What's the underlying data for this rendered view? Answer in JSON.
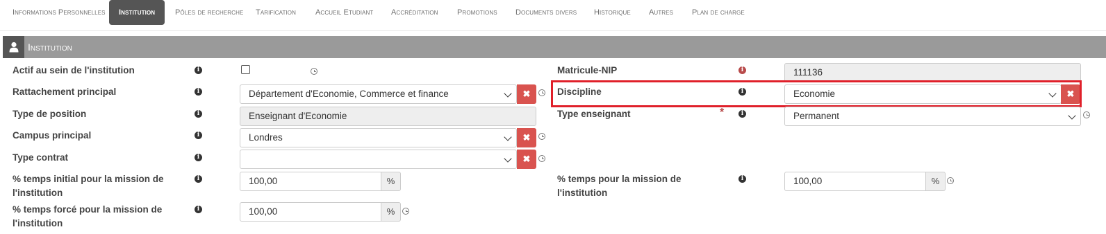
{
  "tabs": [
    {
      "label": "Informations Personnelles"
    },
    {
      "label": "Institution"
    },
    {
      "label": "Pôles de recherche"
    },
    {
      "label": "Tarification"
    },
    {
      "label": "Accueil Etudiant"
    },
    {
      "label": "Accréditation"
    },
    {
      "label": "Promotions"
    },
    {
      "label": "Documents divers"
    },
    {
      "label": "Historique"
    },
    {
      "label": "Autres"
    },
    {
      "label": "Plan de charge"
    }
  ],
  "active_tab": "Institution",
  "section": {
    "title": "Institution",
    "icon": "user-icon"
  },
  "form": {
    "actif": {
      "label": "Actif au sein de l'institution",
      "checked": false
    },
    "rattachement": {
      "label": "Rattachement principal",
      "value": "Département d'Economie, Commerce et finance"
    },
    "type_position": {
      "label": "Type de position",
      "value": "Enseignant d'Economie"
    },
    "campus": {
      "label": "Campus principal",
      "value": "Londres"
    },
    "type_contrat": {
      "label": "Type contrat",
      "value": ""
    },
    "temps_initial": {
      "label_line1": "% temps initial pour la mission de",
      "label_line2": "l'institution",
      "value": "100,00",
      "unit": "%"
    },
    "temps_force": {
      "label_line1": "% temps forcé pour la mission de",
      "label_line2": "l'institution",
      "value": "100,00",
      "unit": "%"
    },
    "matricule": {
      "label": "Matricule-NIP",
      "value": "111136"
    },
    "discipline": {
      "label": "Discipline",
      "value": "Economie"
    },
    "type_enseignant": {
      "label": "Type enseignant",
      "value": "Permanent",
      "required_mark": "*"
    },
    "temps_mission": {
      "label_line1": "% temps pour la mission de",
      "label_line2": "l'institution",
      "value": "100,00",
      "unit": "%"
    }
  },
  "colors": {
    "accent_red": "#d9534f",
    "highlight": "#e0202a",
    "header_bg": "#9a9a9a",
    "tab_active_bg": "#555555"
  }
}
